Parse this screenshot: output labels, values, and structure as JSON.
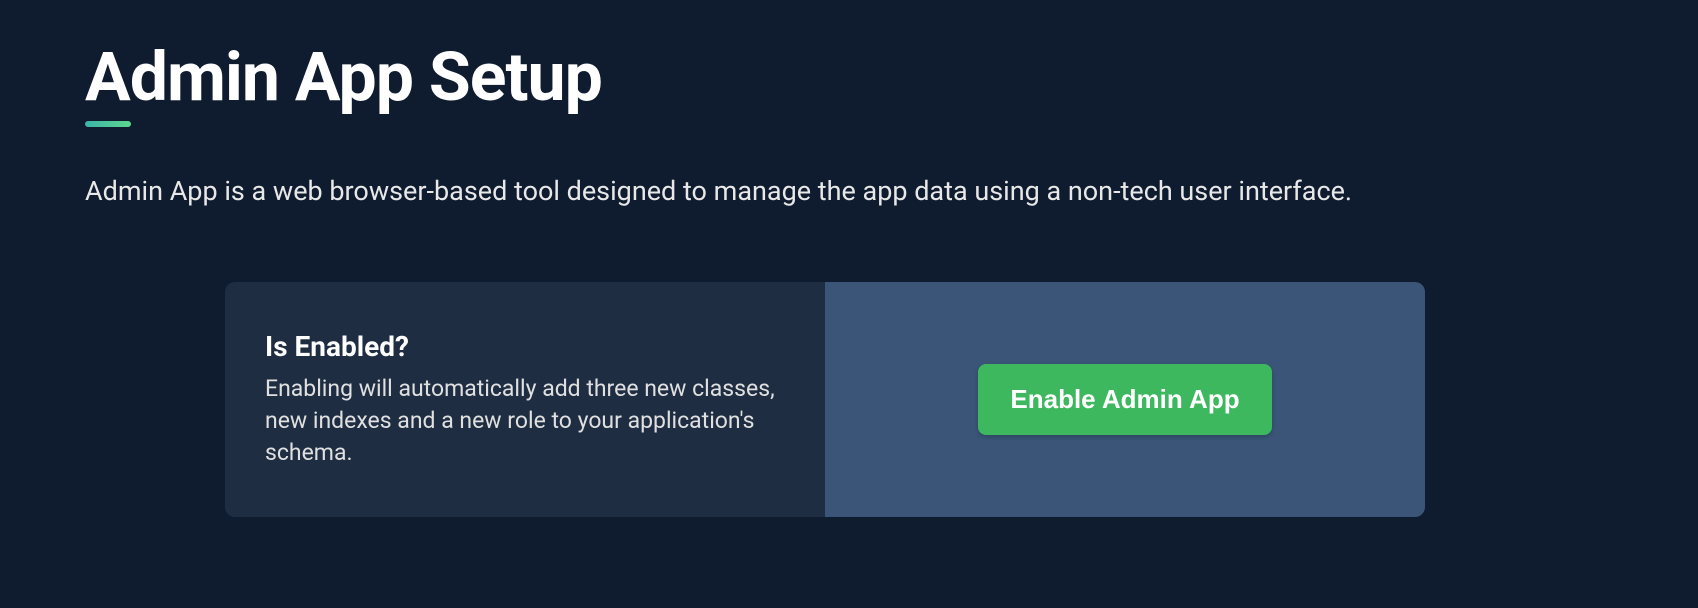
{
  "header": {
    "title": "Admin App Setup",
    "description": "Admin App is a web browser-based tool designed to manage the app data using a non-tech user interface."
  },
  "card": {
    "heading": "Is Enabled?",
    "text": "Enabling will automatically add three new classes, new indexes and a new role to your application's schema.",
    "button_label": "Enable Admin App"
  }
}
